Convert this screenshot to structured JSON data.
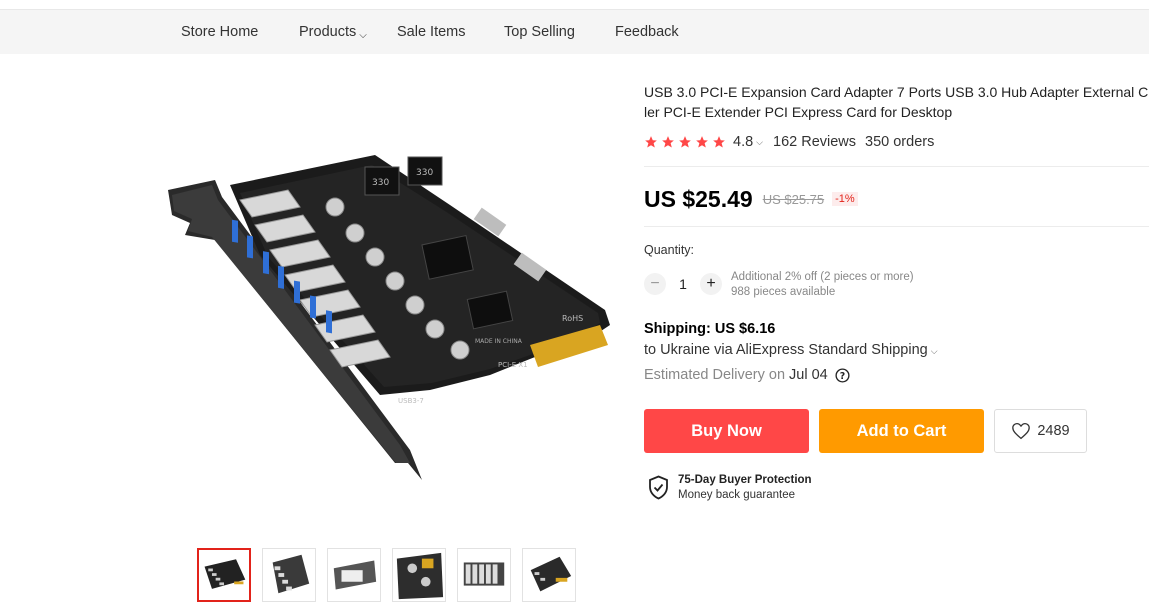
{
  "nav": {
    "items": [
      "Store Home",
      "Products",
      "Sale Items",
      "Top Selling",
      "Feedback"
    ]
  },
  "product": {
    "title_line1": "USB 3.0 PCI-E Expansion Card Adapter 7 Ports USB 3.0 Hub Adapter External C",
    "title_line2": "ler PCI-E Extender PCI Express Card for Desktop",
    "rating": "4.8",
    "stars": 5,
    "reviews": "162 Reviews",
    "orders": "350 orders",
    "price": "US $25.49",
    "old_price": "US $25.75",
    "discount": "-1%",
    "image_labels": {
      "board": "USB3-7",
      "chip": "PCI-E X1",
      "made": "MADE IN CHINA",
      "coil": "330"
    }
  },
  "quantity": {
    "label": "Quantity:",
    "minus": "−",
    "plus": "+",
    "value": "1",
    "note1": "Additional 2% off (2 pieces or more)",
    "note2": "988 pieces available"
  },
  "shipping": {
    "title": "Shipping: US $6.16",
    "line": "to Ukraine via AliExpress Standard Shipping",
    "delivery_label": "Estimated Delivery on",
    "delivery_date": "Jul 04"
  },
  "actions": {
    "buy_now": "Buy Now",
    "add_to_cart": "Add to Cart",
    "wish_count": "2489"
  },
  "protection": {
    "title": "75-Day Buyer Protection",
    "subtitle": "Money back guarantee"
  },
  "colors": {
    "buy": "#ff4747",
    "cart": "#ff9a00",
    "star": "#ff4747",
    "active_thumb": "#e2231a"
  }
}
